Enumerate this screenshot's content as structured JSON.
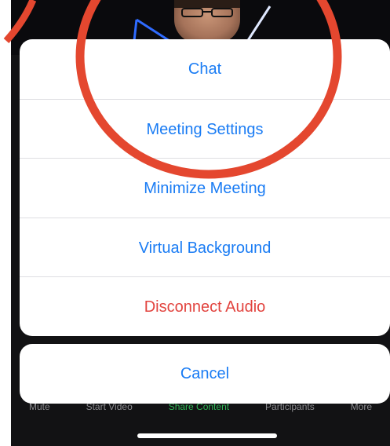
{
  "action_sheet": {
    "items": [
      {
        "label": "Chat"
      },
      {
        "label": "Meeting Settings"
      },
      {
        "label": "Minimize Meeting"
      },
      {
        "label": "Virtual Background"
      },
      {
        "label": "Disconnect Audio",
        "style": "destructive"
      }
    ],
    "cancel_label": "Cancel"
  },
  "toolbar": {
    "items": [
      {
        "label": "Mute"
      },
      {
        "label": "Start Video"
      },
      {
        "label": "Share Content"
      },
      {
        "label": "Participants"
      },
      {
        "label": "More"
      }
    ]
  },
  "colors": {
    "action_text": "#1a7cf4",
    "destructive_text": "#e2443f",
    "annotation_circle": "#e4472f",
    "share_content": "#2fb455"
  }
}
